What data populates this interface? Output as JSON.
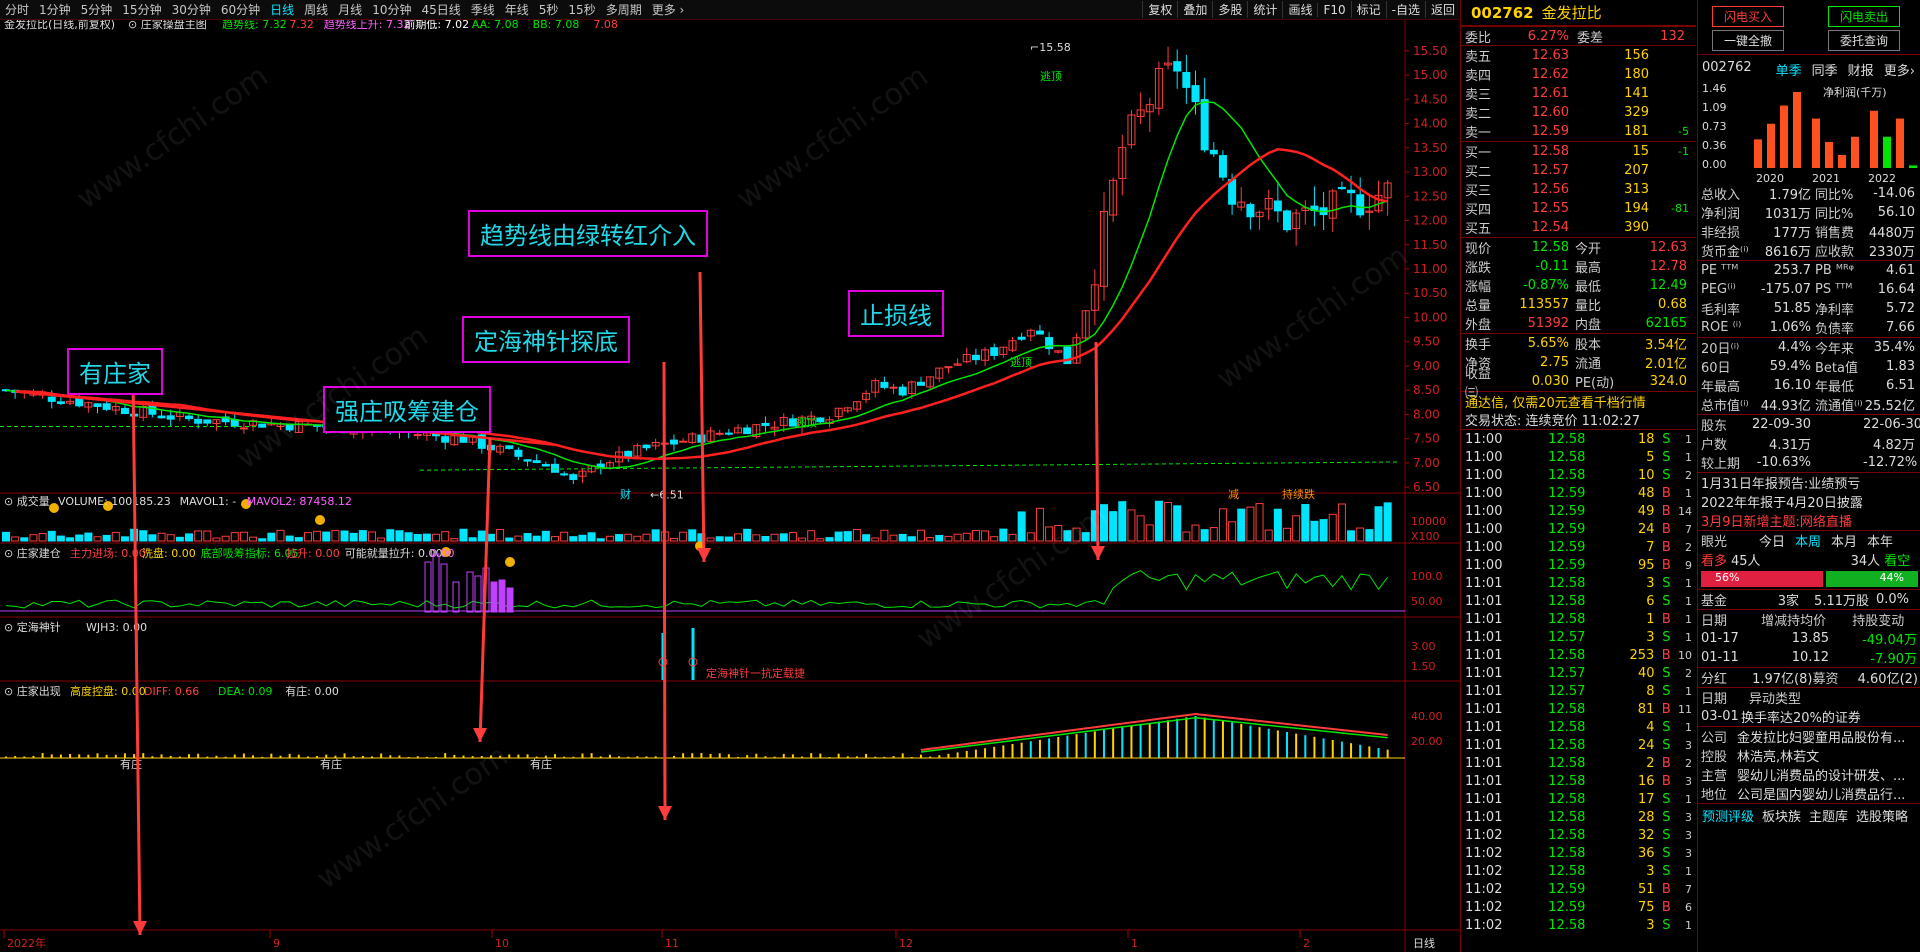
{
  "topbar": {
    "periods": [
      "分时",
      "1分钟",
      "5分钟",
      "15分钟",
      "30分钟",
      "60分钟",
      "日线",
      "周线",
      "月线",
      "10分钟",
      "45日线",
      "季线",
      "年线",
      "5秒",
      "15秒",
      "多周期",
      "更多 ›"
    ],
    "active": "日线",
    "right_buttons": [
      "复权",
      "叠加",
      "多股",
      "统计",
      "画线",
      "F10",
      "标记",
      "-自选",
      "返回"
    ]
  },
  "chart": {
    "title": "金发拉比(日线,前复权)",
    "indicator_name": "庄家操盘主图",
    "legend": [
      {
        "t": "趋势线: 7.32",
        "c": "#00e600"
      },
      {
        "t": "7.32",
        "c": "#ff4040"
      },
      {
        "t": "趋势线上升: 7.32",
        "c": "#ff60ff"
      },
      {
        "t": "前期低: 7.02",
        "c": "#ffffff"
      },
      {
        "t": "AA: 7.08",
        "c": "#00e600"
      },
      {
        "t": "BB: 7.08",
        "c": "#00e600"
      },
      {
        "t": "7.08",
        "c": "#ff4040"
      }
    ],
    "price_ticks": [
      "15.50",
      "15.00",
      "14.50",
      "14.00",
      "13.50",
      "13.00",
      "12.50",
      "12.00",
      "11.50",
      "11.00",
      "10.50",
      "10.00",
      "9.50",
      "9.00",
      "8.50",
      "8.00",
      "7.50",
      "7.00",
      "6.50"
    ],
    "high_label": "15.58",
    "low_label": "6.51",
    "ann_labels": [
      "逃顶",
      "逃顶",
      "逃顶",
      "财",
      "减",
      "持续跌"
    ],
    "volume": {
      "title": "成交量",
      "legend": [
        {
          "t": "VOLUME: 100185.23",
          "c": "#ddd"
        },
        {
          "t": "MAVOL1: -",
          "c": "#ddd"
        },
        {
          "t": "MAVOL2: 87458.12",
          "c": "#ff60ff"
        }
      ],
      "ticks": [
        "10000",
        "X100"
      ]
    },
    "build": {
      "title": "庄家建仓",
      "legend": [
        {
          "t": "主力进场: 0.00",
          "c": "#ff4040"
        },
        {
          "t": "洗盘: 0.00",
          "c": "#ffd200"
        },
        {
          "t": "底部吸筹指标: 6.05",
          "c": "#00e600"
        },
        {
          "t": "拉升: 0.00",
          "c": "#ff4040"
        },
        {
          "t": "可能就量拉升: 0.00",
          "c": "#ddd"
        },
        {
          "t": "0.00",
          "c": "#ff60ff"
        }
      ],
      "ticks": [
        "100.0",
        "50.00"
      ]
    },
    "needle": {
      "title": "定海神针",
      "legend": [
        {
          "t": "WJH3: 0.00",
          "c": "#ddd"
        }
      ],
      "ticks": [
        "3.00",
        "1.50"
      ],
      "note": "定海神针一抗定载捷"
    },
    "appear": {
      "title": "庄家出现",
      "legend": [
        {
          "t": "高度控盘: 0.00",
          "c": "#ffd200"
        },
        {
          "t": "DIFF: 0.66",
          "c": "#ff4040"
        },
        {
          "t": "DEA: 0.09",
          "c": "#00e600"
        },
        {
          "t": "有庄: 0.00",
          "c": "#ddd"
        }
      ],
      "ticks": [
        "40.00",
        "20.00"
      ],
      "marks": [
        "有庄",
        "有庄",
        "有庄"
      ]
    },
    "xaxis": [
      "2022年",
      "9",
      "10",
      "11",
      "12",
      "1",
      "2"
    ],
    "period_label": "日线",
    "annotations": [
      "有庄家",
      "强庄吸筹建仓",
      "定海神针探底",
      "趋势线由绿转红介入",
      "止损线"
    ]
  },
  "quote": {
    "code": "002762",
    "name": "金发拉比",
    "ratio": {
      "label": "委比",
      "value": "6.27%",
      "label2": "委差",
      "value2": "132"
    },
    "asks": [
      {
        "l": "卖五",
        "p": "12.63",
        "v": "156",
        "d": ""
      },
      {
        "l": "卖四",
        "p": "12.62",
        "v": "180",
        "d": ""
      },
      {
        "l": "卖三",
        "p": "12.61",
        "v": "141",
        "d": ""
      },
      {
        "l": "卖二",
        "p": "12.60",
        "v": "329",
        "d": ""
      },
      {
        "l": "卖一",
        "p": "12.59",
        "v": "181",
        "d": "-5"
      }
    ],
    "bids": [
      {
        "l": "买一",
        "p": "12.58",
        "v": "15",
        "d": "-1"
      },
      {
        "l": "买二",
        "p": "12.57",
        "v": "207",
        "d": ""
      },
      {
        "l": "买三",
        "p": "12.56",
        "v": "313",
        "d": ""
      },
      {
        "l": "买四",
        "p": "12.55",
        "v": "194",
        "d": "-81"
      },
      {
        "l": "买五",
        "p": "12.54",
        "v": "390",
        "d": ""
      }
    ],
    "stats": [
      {
        "a": "现价",
        "b": "12.58",
        "bc": "grn",
        "c": "今开",
        "d": "12.63",
        "dc": "red"
      },
      {
        "a": "涨跌",
        "b": "-0.11",
        "bc": "grn",
        "c": "最高",
        "d": "12.78",
        "dc": "red"
      },
      {
        "a": "涨幅",
        "b": "-0.87%",
        "bc": "grn",
        "c": "最低",
        "d": "12.49",
        "dc": "grn"
      },
      {
        "a": "总量",
        "b": "113557",
        "bc": "yel",
        "c": "量比",
        "d": "0.68",
        "dc": "yel"
      },
      {
        "a": "外盘",
        "b": "51392",
        "bc": "red",
        "c": "内盘",
        "d": "62165",
        "dc": "grn"
      }
    ],
    "stats2": [
      {
        "a": "换手",
        "b": "5.65%",
        "c": "股本",
        "d": "3.54亿"
      },
      {
        "a": "净资",
        "b": "2.75",
        "c": "流通",
        "d": "2.01亿"
      },
      {
        "a": "收益㈢",
        "b": "0.030",
        "c": "PE(动)",
        "d": "324.0"
      }
    ],
    "notice": "通达信, 仅需20元查看千档行情",
    "trade_state": "交易状态: 连续竞价 11:02:27",
    "ticks": [
      [
        "11:00",
        "12.58",
        "18",
        "S",
        "1"
      ],
      [
        "11:00",
        "12.58",
        "5",
        "S",
        "1"
      ],
      [
        "11:00",
        "12.58",
        "10",
        "S",
        "2"
      ],
      [
        "11:00",
        "12.59",
        "48",
        "B",
        "1"
      ],
      [
        "11:00",
        "12.59",
        "49",
        "B",
        "14"
      ],
      [
        "11:00",
        "12.59",
        "24",
        "B",
        "7"
      ],
      [
        "11:00",
        "12.59",
        "7",
        "B",
        "2"
      ],
      [
        "11:00",
        "12.59",
        "95",
        "B",
        "9"
      ],
      [
        "11:01",
        "12.58",
        "3",
        "S",
        "1"
      ],
      [
        "11:01",
        "12.58",
        "6",
        "S",
        "1"
      ],
      [
        "11:01",
        "12.58",
        "1",
        "B",
        "1"
      ],
      [
        "11:01",
        "12.57",
        "3",
        "S",
        "1"
      ],
      [
        "11:01",
        "12.58",
        "253",
        "B",
        "10"
      ],
      [
        "11:01",
        "12.57",
        "40",
        "S",
        "2"
      ],
      [
        "11:01",
        "12.57",
        "8",
        "S",
        "1"
      ],
      [
        "11:01",
        "12.58",
        "81",
        "B",
        "11"
      ],
      [
        "11:01",
        "12.58",
        "4",
        "S",
        "1"
      ],
      [
        "11:01",
        "12.58",
        "24",
        "S",
        "3"
      ],
      [
        "11:01",
        "12.58",
        "2",
        "B",
        "2"
      ],
      [
        "11:01",
        "12.58",
        "16",
        "B",
        "3"
      ],
      [
        "11:01",
        "12.58",
        "17",
        "S",
        "1"
      ],
      [
        "11:01",
        "12.58",
        "28",
        "S",
        "3"
      ],
      [
        "11:02",
        "12.58",
        "32",
        "S",
        "3"
      ],
      [
        "11:02",
        "12.58",
        "36",
        "S",
        "3"
      ],
      [
        "11:02",
        "12.58",
        "3",
        "S",
        "1"
      ],
      [
        "11:02",
        "12.59",
        "51",
        "B",
        "7"
      ],
      [
        "11:02",
        "12.59",
        "75",
        "B",
        "6"
      ],
      [
        "11:02",
        "12.58",
        "3",
        "S",
        "1"
      ]
    ]
  },
  "f10": {
    "buttons": [
      "闪电买入",
      "闪电卖出",
      "一键全撤",
      "委托查询"
    ],
    "code": "002762",
    "tabs": [
      "单季",
      "同季",
      "财报",
      "更多›"
    ],
    "chart": {
      "y_ticks": [
        "1.46",
        "1.09",
        "0.73",
        "0.36",
        "0.00"
      ],
      "years": [
        "2020",
        "2021",
        "2022"
      ],
      "legend": "净利润(千万)",
      "values": [
        0.55,
        0.85,
        1.2,
        1.46,
        0.95,
        0.5,
        0.25,
        0.6,
        1.1,
        0.6,
        0.95,
        0.05
      ]
    },
    "rows1": [
      {
        "l": "总收入",
        "v1": "1.79亿",
        "l2": "同比%",
        "v2": "-14.06",
        "c2": "grn"
      },
      {
        "l": "净利润",
        "v1": "1031万",
        "l2": "同比%",
        "v2": "56.10",
        "c2": "red"
      },
      {
        "l": "非经损",
        "v1": "177万",
        "l2": "销售费",
        "v2": "4480万",
        "c2": "wht"
      },
      {
        "l": "货币金⁽ⁱ⁾",
        "v1": "8616万",
        "l2": "应收款",
        "v2": "2330万",
        "c2": "wht"
      }
    ],
    "rows2": [
      {
        "l": "PE ᵀᵀᴹ",
        "v1": "253.7",
        "l2": "PB ᴹᴿᵠ",
        "v2": "4.61",
        "c1": "wht",
        "c2": "wht"
      },
      {
        "l": "PEG⁽ⁱ⁾",
        "v1": "-175.07",
        "l2": "PS ᵀᵀᴹ",
        "v2": "16.64",
        "c1": "wht",
        "c2": "wht"
      },
      {
        "l": "毛利率",
        "v1": "51.85",
        "l2": "净利率",
        "v2": "5.72",
        "c1": "wht",
        "c2": "wht"
      },
      {
        "l": "ROE ⁽ⁱ⁾",
        "v1": "1.06%",
        "l2": "负债率",
        "v2": "7.66",
        "c1": "wht",
        "c2": "wht"
      }
    ],
    "rows3": [
      {
        "l": "20日⁽ⁱ⁾",
        "v1": "4.4%",
        "l2": "今年来",
        "v2": "35.4%",
        "c1": "red",
        "c2": "red"
      },
      {
        "l": "60日",
        "v1": "59.4%",
        "l2": "Beta值",
        "v2": "1.83",
        "c1": "red",
        "c2": "wht"
      },
      {
        "l": "年最高",
        "v1": "16.10",
        "l2": "年最低",
        "v2": "6.51",
        "c1": "wht",
        "c2": "wht"
      },
      {
        "l": "总市值⁽ⁱ⁾",
        "v1": "44.93亿",
        "l2": "流通值⁽ⁱ⁾",
        "v2": "25.52亿",
        "c1": "wht",
        "c2": "wht"
      }
    ],
    "rows4": [
      {
        "l": "股东",
        "v1": "22-09-30",
        "l2": "",
        "v2": "22-06-30",
        "c1": "wht",
        "c2": "wht"
      },
      {
        "l": "户数",
        "v1": "4.31万",
        "l2": "",
        "v2": "4.82万",
        "c1": "wht",
        "c2": "wht"
      },
      {
        "l": "较上期",
        "v1": "-10.63%",
        "l2": "",
        "v2": "-12.72%",
        "c1": "grn",
        "c2": "grn"
      }
    ],
    "news": [
      {
        "t": "1月31日年报预告:业绩预亏",
        "c": "wht"
      },
      {
        "t": "2022年年报于4月20日披露",
        "c": "wht"
      },
      {
        "t": "3月9日新增主题:网络直播",
        "c": "red"
      }
    ],
    "vision": {
      "label": "眼光",
      "tabs": [
        "今日",
        "本周",
        "本月",
        "本年"
      ],
      "bull": "看多",
      "bull_n": "45人",
      "bear_n": "34人",
      "bear": "看空",
      "bull_pct": "56%",
      "bear_pct": "44%",
      "bull_frac": 0.56
    },
    "fund": {
      "l": "基金",
      "a": "3家",
      "b": "5.11万股",
      "c": "0.0%"
    },
    "hold_head": [
      "日期",
      "增减持均价",
      "持股变动"
    ],
    "holds": [
      {
        "d": "01-17",
        "p": "13.85",
        "v": "-49.04万",
        "c": "grn"
      },
      {
        "d": "01-11",
        "p": "10.12",
        "v": "-7.90万",
        "c": "grn"
      }
    ],
    "div": {
      "l": "分红",
      "a": "1.97亿(8)",
      "b": "募资",
      "c": "4.60亿(2)"
    },
    "abn_head": [
      "日期",
      "异动类型"
    ],
    "abn": {
      "d": "03-01",
      "t": "换手率达20%的证券"
    },
    "info": [
      {
        "l": "公司",
        "t": "金发拉比妇婴童用品股份有..."
      },
      {
        "l": "控股",
        "t": "林浩亮,林若文"
      },
      {
        "l": "主营",
        "t": "婴幼儿消费品的设计研发、..."
      },
      {
        "l": "地位",
        "t": "公司是国内婴幼儿消费品行..."
      }
    ],
    "footer": [
      "预测评级",
      "板块族",
      "主题库",
      "选股策略"
    ]
  }
}
